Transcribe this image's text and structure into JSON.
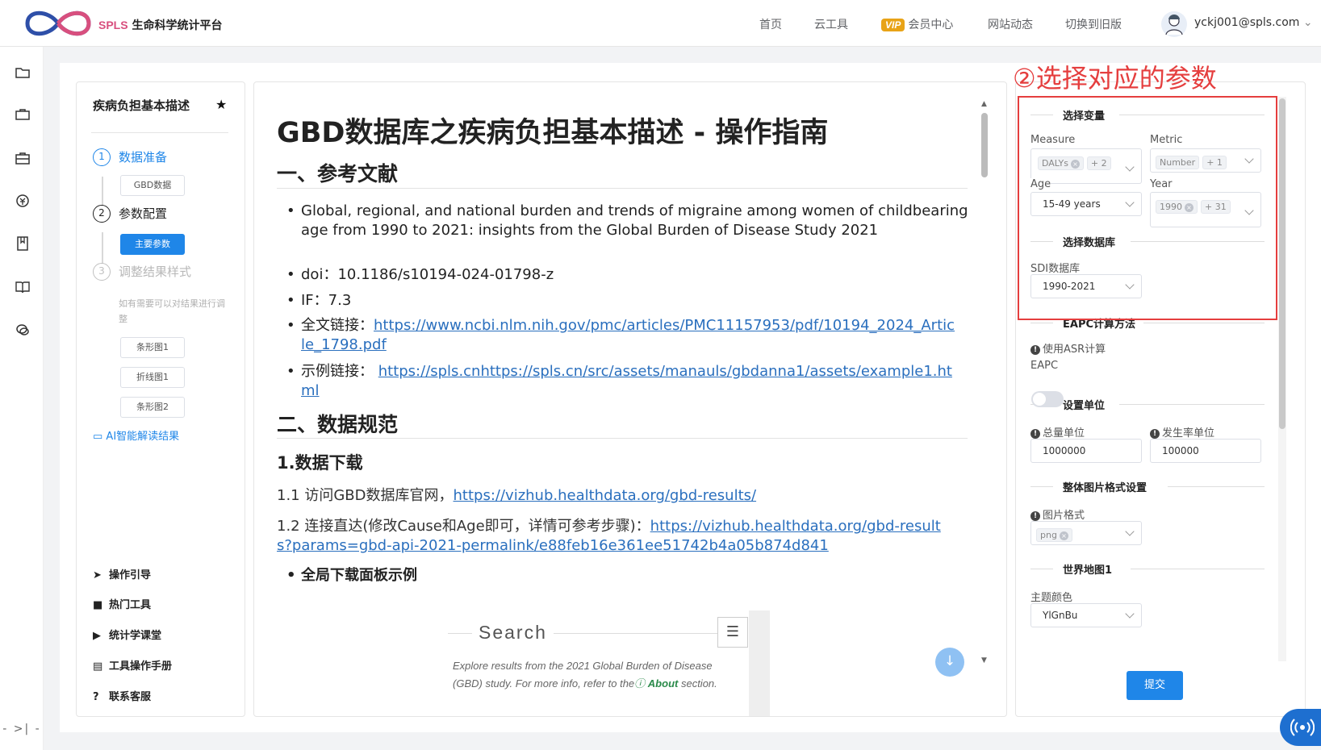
{
  "header": {
    "logo_text": "SPLS",
    "logo_subtitle": "生命科学统计平台",
    "nav": [
      "首页",
      "云工具",
      "会员中心",
      "网站动态",
      "切换到旧版"
    ],
    "vip_badge": "VIP",
    "user": "yckj001@spls.com"
  },
  "left_panel": {
    "title": "疾病负担基本描述",
    "steps": [
      {
        "num": "1",
        "label": "数据准备",
        "state": "done"
      },
      {
        "num": "2",
        "label": "参数配置",
        "state": "active"
      },
      {
        "num": "3",
        "label": "调整结果样式",
        "state": "pending"
      }
    ],
    "step1_buttons": [
      "GBD数据"
    ],
    "step2_buttons": [
      "主要参数"
    ],
    "step3_hint": "如有需要可以对结果进行调整",
    "step3_buttons": [
      "条形图1",
      "折线图1",
      "条形图2"
    ],
    "ai_link": "AI智能解读结果",
    "menu": [
      "操作引导",
      "热门工具",
      "统计学课堂",
      "工具操作手册",
      "联系客服"
    ]
  },
  "doc": {
    "title": "GBD数据库之疾病负担基本描述 - 操作指南",
    "section1": "一、参考文献",
    "ref_title": "Global, regional, and national burden and trends of migraine among women of childbearing age from 1990 to 2021: insights from the Global Burden of Disease Study 2021",
    "doi_label": "doi：",
    "doi": "10.1186/s10194-024-01798-z",
    "if_label": "IF：",
    "if_value": "7.3",
    "fulltext_label": "全文链接：",
    "fulltext_url_1": "https://www.ncbi.nlm.nih.gov/pmc/articles/PMC11157953/pdf/10194_2024_Artic",
    "fulltext_url_2": "le_1798.pdf",
    "example_label": "示例链接：",
    "example_url_1": "https://spls.cnhttps://spls.cn/src/assets/manauls/gbdanna1/assets/example1.ht",
    "example_url_2": "ml",
    "section2": "二、数据规范",
    "sub1": "1.数据下载",
    "p1_text": "1.1 访问GBD数据库官网，",
    "p1_url": "https://vizhub.healthdata.org/gbd-results/",
    "p2_text": "1.2 连接直达(修改Cause和Age即可，详情可参考步骤)：",
    "p2_url_1": "https://vizhub.healthdata.org/gbd-result",
    "p2_url_2": "s?params=gbd-api-2021-permalink/e88feb16e361ee51742b4a05b874d841",
    "bullet_bold": "全局下载面板示例",
    "embed": {
      "search": "Search",
      "desc_1": "Explore results from the 2021 Global Burden of Disease",
      "desc_2a": "(GBD) study. For more info, refer to the",
      "desc_about": "About",
      "desc_2b": "section."
    }
  },
  "right_panel": {
    "annotation": "②选择对应的参数",
    "sec_vars": "选择变量",
    "measure_label": "Measure",
    "measure_tag": "DALYs",
    "measure_more": "+ 2",
    "metric_label": "Metric",
    "metric_tag": "Number",
    "metric_more": "+ 1",
    "age_label": "Age",
    "age_value": "15-49 years",
    "year_label": "Year",
    "year_tag": "1990",
    "year_more": "+ 31",
    "sec_db": "选择数据库",
    "sdi_label": "SDI数据库",
    "sdi_value": "1990-2021",
    "sec_eapc": "EAPC计算方法",
    "asr_label_1": "使用ASR计算",
    "asr_label_2": "EAPC",
    "sec_units": "设置单位",
    "total_unit_label": "总量单位",
    "total_unit_value": "1000000",
    "rate_unit_label": "发生率单位",
    "rate_unit_value": "100000",
    "sec_img": "整体图片格式设置",
    "img_format_label": "图片格式",
    "img_format_tag": "png",
    "sec_map": "世界地图1",
    "theme_label": "主题颜色",
    "theme_value": "YlGnBu",
    "submit": "提交"
  }
}
